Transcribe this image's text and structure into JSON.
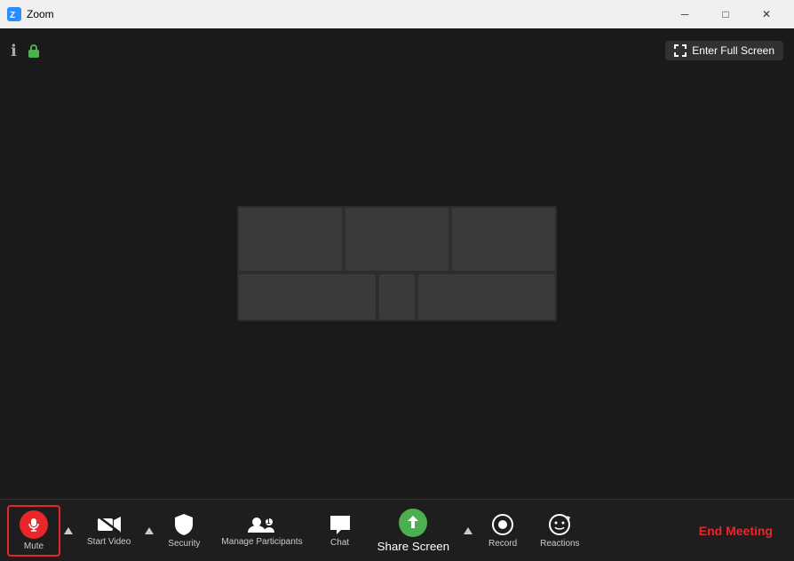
{
  "titleBar": {
    "appName": "Zoom",
    "minimize": "─",
    "maximize": "□",
    "close": "✕"
  },
  "topOverlay": {
    "fullscreenLabel": "Enter Full Screen"
  },
  "toolbar": {
    "muteLabel": "Mute",
    "startVideoLabel": "Start Video",
    "securityLabel": "Security",
    "manageParticipantsLabel": "Manage Participants",
    "participantCount": "1",
    "chatLabel": "Chat",
    "shareScreenLabel": "Share Screen",
    "recordLabel": "Record",
    "reactionsLabel": "Reactions",
    "endMeetingLabel": "End Meeting"
  }
}
